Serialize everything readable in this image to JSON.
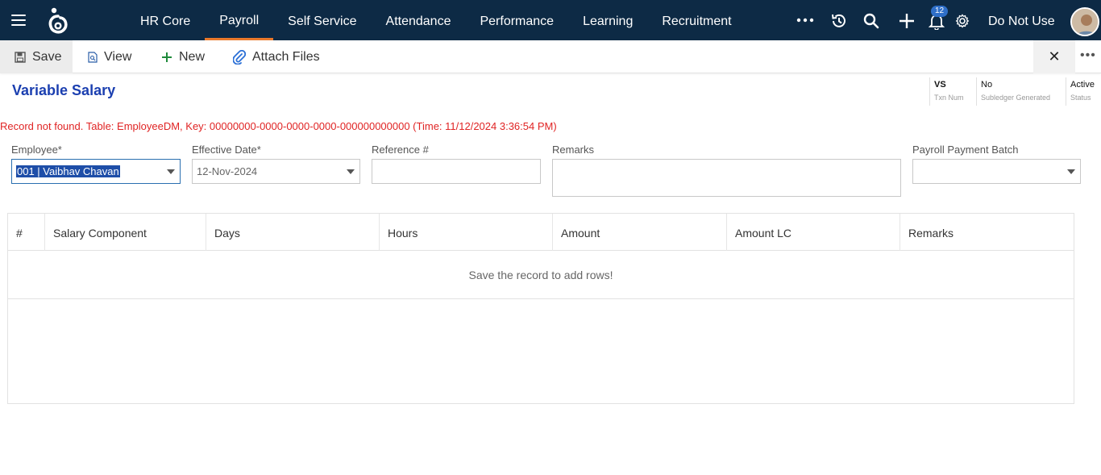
{
  "nav": {
    "links": [
      {
        "label": "HR Core"
      },
      {
        "label": "Payroll"
      },
      {
        "label": "Self Service"
      },
      {
        "label": "Attendance"
      },
      {
        "label": "Performance"
      },
      {
        "label": "Learning"
      },
      {
        "label": "Recruitment"
      }
    ],
    "active": "Payroll",
    "notification_count": "12",
    "user_label": "Do Not Use",
    "accent_color": "#e9792b",
    "bar_color": "#0d2a45"
  },
  "toolbar": {
    "save_label": "Save",
    "view_label": "View",
    "new_label": "New",
    "attach_label": "Attach Files",
    "close_symbol": "✕",
    "more_symbol": "•••"
  },
  "header": {
    "title": "Variable Salary",
    "txn_num_value": "VS",
    "txn_num_label": "Txn Num",
    "subledger_value": "No",
    "subledger_label": "Subledger Generated",
    "status_value": "Active",
    "status_label": "Status"
  },
  "error_message": "Record not found. Table: EmployeeDM, Key: 00000000-0000-0000-0000-000000000000 (Time: 11/12/2024 3:36:54 PM)",
  "form": {
    "employee_label": "Employee*",
    "employee_value": "001 | Vaibhav Chavan",
    "effective_date_label": "Effective Date*",
    "effective_date_value": "12-Nov-2024",
    "reference_label": "Reference #",
    "reference_value": "",
    "remarks_label": "Remarks",
    "remarks_value": "",
    "batch_label": "Payroll Payment Batch",
    "batch_value": ""
  },
  "grid": {
    "columns": [
      "#",
      "Salary Component",
      "Days",
      "Hours",
      "Amount",
      "Amount LC",
      "Remarks"
    ],
    "empty_message": "Save the record to add rows!"
  }
}
